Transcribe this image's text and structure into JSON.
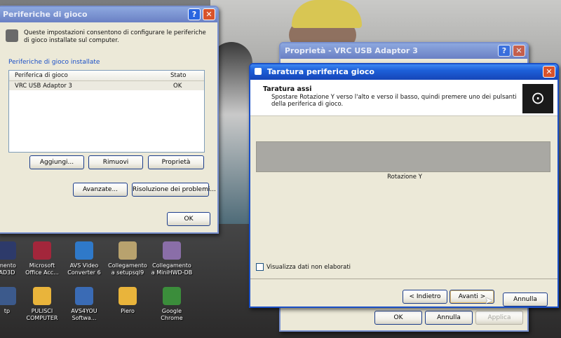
{
  "desktop": {
    "icons": [
      {
        "label": "mento\nAD3D",
        "icon": "app-icon",
        "color": "#2d3a6a"
      },
      {
        "label": "Microsoft\nOffice Acc...",
        "icon": "access-icon",
        "color": "#a3263b"
      },
      {
        "label": "AVS Video\nConverter 6",
        "icon": "video-converter-icon",
        "color": "#2f79c9"
      },
      {
        "label": "Collegamento\na setupsql9",
        "icon": "shortcut-icon",
        "color": "#b8a26e"
      },
      {
        "label": "Collegamento\na MiniHWD-DB",
        "icon": "shortcut-icon",
        "color": "#8a6ea8"
      },
      {
        "label": "tp",
        "icon": "app-icon",
        "color": "#3c5a8c"
      },
      {
        "label": "PULISCI\nCOMPUTER",
        "icon": "folder-icon",
        "color": "#e9b43b"
      },
      {
        "label": "AVS4YOU\nSoftwa...",
        "icon": "avs4you-icon",
        "color": "#3a6bb5"
      },
      {
        "label": "Piero",
        "icon": "folder-icon",
        "color": "#e9b43b"
      },
      {
        "label": "Google\nChrome",
        "icon": "chrome-icon",
        "color": "#3b8d3b"
      }
    ]
  },
  "game_controllers": {
    "title": "Periferiche di gioco",
    "description": "Queste impostazioni consentono di configurare le periferiche di gioco installate sul computer.",
    "group_label": "Periferiche di gioco installate",
    "columns": [
      "Periferica di gioco",
      "Stato"
    ],
    "rows": [
      {
        "device": "VRC USB Adaptor 3",
        "status": "OK"
      }
    ],
    "buttons": {
      "add": "Aggiungi...",
      "remove": "Rimuovi",
      "properties": "Proprietà",
      "advanced": "Avanzate...",
      "troubleshoot": "Risoluzione dei problemi...",
      "ok": "OK"
    }
  },
  "properties_window": {
    "title": "Proprietà - VRC USB Adaptor 3",
    "buttons": {
      "ok": "OK",
      "cancel": "Annulla",
      "apply": "Applica"
    }
  },
  "calibration": {
    "title": "Taratura periferica gioco",
    "section_title": "Taratura assi",
    "instruction": "Spostare Rotazione Y verso l'alto e verso il basso, quindi premere uno dei pulsanti della periferica di gioco.",
    "axis_label": "Rotazione Y",
    "axis_progress": 0.0,
    "raw_data_checkbox": "Visualizza dati non elaborati",
    "raw_data_checked": false,
    "buttons": {
      "back": "< Indietro",
      "next": "Avanti >",
      "cancel": "Annulla"
    }
  },
  "colors": {
    "titlebar": "#1d5fd8",
    "dialog_bg": "#ece9d8",
    "close_button": "#d9532b"
  }
}
